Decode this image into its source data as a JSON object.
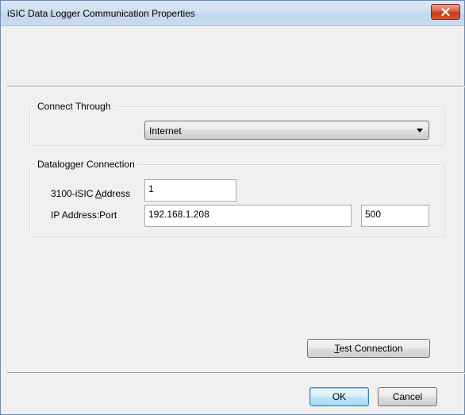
{
  "window": {
    "title": "iSIC Data Logger Communication Properties"
  },
  "connect_through": {
    "group_label": "Connect Through",
    "selected": "Internet"
  },
  "datalogger": {
    "group_label": "Datalogger Connection",
    "address_label_pre": "3100-iSIC ",
    "address_label_mnemonic": "A",
    "address_label_post": "ddress",
    "address_value": "1",
    "ip_label": "IP Address:Port",
    "ip_value": "192.168.1.208",
    "port_value": "500"
  },
  "buttons": {
    "test_mnemonic": "T",
    "test_rest": "est Connection",
    "ok": "OK",
    "cancel": "Cancel"
  },
  "icons": {
    "close": "close-icon",
    "dropdown": "chevron-down-icon"
  }
}
